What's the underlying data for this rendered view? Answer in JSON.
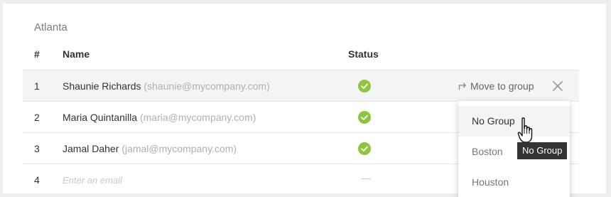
{
  "group": {
    "title": "Atlanta"
  },
  "table": {
    "headers": {
      "num": "#",
      "name": "Name",
      "status": "Status"
    },
    "rows": [
      {
        "num": "1",
        "name": "Shaunie Richards",
        "email": "(shaunie@mycompany.com)",
        "status": "active"
      },
      {
        "num": "2",
        "name": "Maria Quintanilla",
        "email": "(maria@mycompany.com)",
        "status": "active"
      },
      {
        "num": "3",
        "name": "Jamal Daher",
        "email": "(jamal@mycompany.com)",
        "status": "active"
      }
    ],
    "new_row": {
      "num": "4",
      "placeholder": "Enter an email",
      "status": "—"
    }
  },
  "row_actions": {
    "move_label": "Move to group"
  },
  "dropdown": {
    "items": [
      {
        "label": "No Group"
      },
      {
        "label": "Boston"
      },
      {
        "label": "Houston"
      }
    ]
  },
  "tooltip": {
    "text": "No Group"
  },
  "colors": {
    "check": "#8cc63f",
    "text": "#333333",
    "muted": "#b0b0b0",
    "hover_bg": "#f4f4f4",
    "tooltip_bg": "#333333"
  }
}
